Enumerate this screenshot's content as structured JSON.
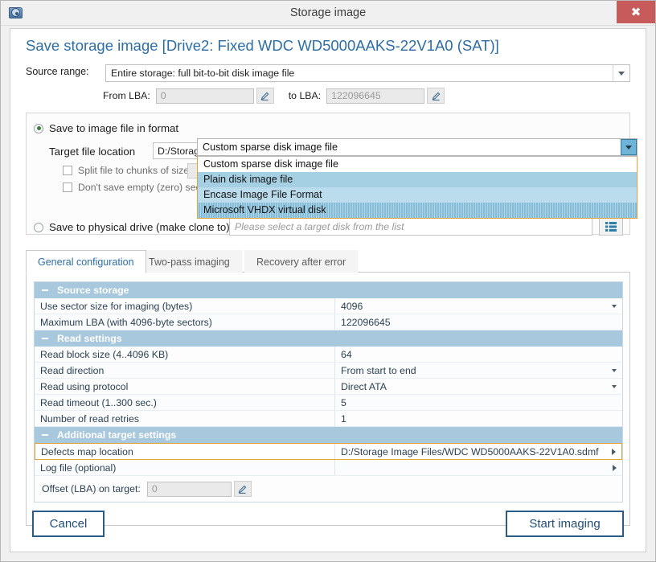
{
  "window": {
    "title": "Storage image",
    "app_icon": "disk-folder-icon",
    "close_label": "✖"
  },
  "page": {
    "title": "Save storage image [Drive2: Fixed WDC WD5000AAKS-22V1A0 (SAT)]"
  },
  "source_range": {
    "label": "Source range:",
    "value": "Entire storage: full bit-to-bit disk image file",
    "from_lba_label": "From LBA:",
    "from_lba_value": "0",
    "to_lba_label": "to LBA:",
    "to_lba_value": "122096645"
  },
  "destination": {
    "image_file_radio_label": "Save to image file in format",
    "image_file_radio_selected": true,
    "format_value": "Custom sparse disk image file",
    "format_options": [
      "Custom sparse disk image file",
      "Plain disk image file",
      "Encase Image File Format",
      "Microsoft VHDX virtual disk"
    ],
    "target_location_label": "Target file location",
    "target_location_value": "D:/Storage",
    "split_checkbox_label": "Split file to chunks of size:",
    "split_checked": false,
    "no_empty_checkbox_label": "Don't save empty (zero) sector",
    "no_empty_checked": false,
    "physical_radio_label": "Save to physical drive (make clone to)",
    "physical_radio_selected": false,
    "physical_placeholder": "Please select a target disk from the list",
    "list_button_icon": "list-icon"
  },
  "tabs": [
    {
      "label": "General configuration",
      "active": true
    },
    {
      "label": "Two-pass imaging",
      "active": false
    },
    {
      "label": "Recovery after error",
      "active": false
    }
  ],
  "settings": {
    "sections": [
      {
        "title": "Source storage",
        "rows": [
          {
            "name": "Use sector size for imaging (bytes)",
            "value": "4096",
            "control": "dropdown"
          },
          {
            "name": "Maximum LBA (with 4096-byte sectors)",
            "value": "122096645",
            "control": "none"
          }
        ]
      },
      {
        "title": "Read settings",
        "rows": [
          {
            "name": "Read block size (4..4096 KB)",
            "value": "64",
            "control": "none"
          },
          {
            "name": "Read direction",
            "value": "From start to end",
            "control": "dropdown"
          },
          {
            "name": "Read using protocol",
            "value": "Direct ATA",
            "control": "dropdown"
          },
          {
            "name": "Read timeout (1..300 sec.)",
            "value": "5",
            "control": "none"
          },
          {
            "name": "Number of read retries",
            "value": "1",
            "control": "none"
          }
        ]
      },
      {
        "title": "Additional target settings",
        "rows": [
          {
            "name": "Defects map location",
            "value": "D:/Storage Image Files/WDC WD5000AAKS-22V1A0.sdmf",
            "control": "browse",
            "highlighted": true
          },
          {
            "name": "Log file (optional)",
            "value": "",
            "control": "browse"
          }
        ]
      }
    ],
    "offset_label": "Offset (LBA) on target:",
    "offset_value": "0"
  },
  "footer": {
    "cancel_label": "Cancel",
    "start_label": "Start imaging"
  },
  "colors": {
    "accent": "#2e6da4",
    "section_header": "#a8c8dd",
    "highlight_border": "#e2a33a",
    "close_button": "#c75b5b",
    "dropdown_selected": "#86bdd8"
  }
}
